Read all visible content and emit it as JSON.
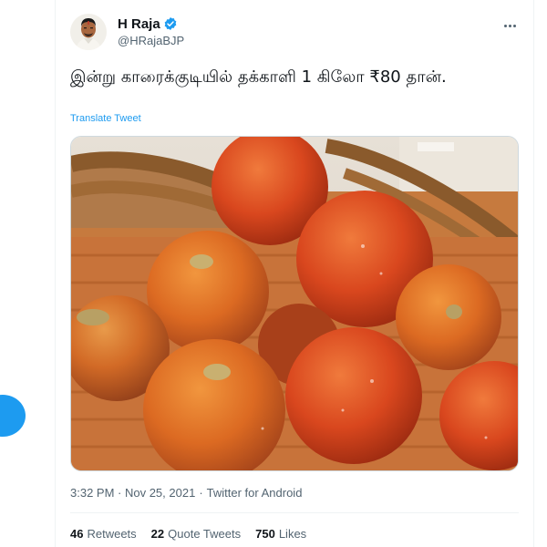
{
  "tweet": {
    "author": {
      "display_name": "H Raja",
      "handle": "@HRajaBJP",
      "verified": true
    },
    "text": "இன்று காரைக்குடியில் தக்காளி 1 கிலோ ₹80 தான்.",
    "translate_label": "Translate Tweet",
    "media": {
      "kind": "photo",
      "subject": "tomatoes-in-wicker-basket"
    },
    "timestamp": "3:32 PM · Nov 25, 2021",
    "separator": "·",
    "source": "Twitter for Android",
    "stats": [
      {
        "count": "46",
        "label": "Retweets"
      },
      {
        "count": "22",
        "label": "Quote Tweets"
      },
      {
        "count": "750",
        "label": "Likes"
      }
    ]
  },
  "icons": {
    "verified": "verified-badge-icon",
    "more": "more-options-icon",
    "compose": "compose-tweet-icon"
  },
  "colors": {
    "accent": "#1d9bf0",
    "text_primary": "#0f1419",
    "text_secondary": "#536471",
    "border": "#eff3f4"
  }
}
